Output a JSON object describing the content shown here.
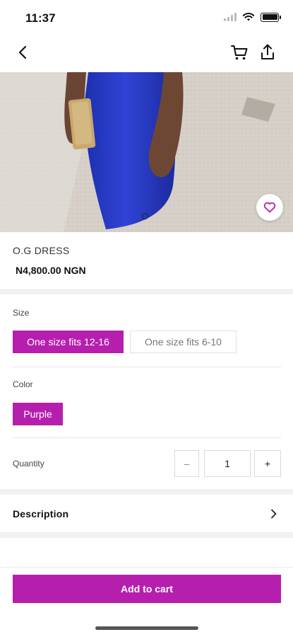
{
  "status_bar": {
    "time": "11:37"
  },
  "nav": {
    "back_icon": "chevron-left-icon",
    "cart_icon": "cart-icon",
    "share_icon": "share-icon"
  },
  "product": {
    "name": "O.G DRESS",
    "price": "N4,800.00 NGN",
    "image_description": "model in blue dress holding gold clutch",
    "carousel_index": 1,
    "carousel_count": 1
  },
  "size": {
    "label": "Size",
    "options": [
      "One size fits 12-16",
      "One size fits 6-10"
    ],
    "selected": "One size fits 12-16"
  },
  "color": {
    "label": "Color",
    "options": [
      "Purple"
    ],
    "selected": "Purple"
  },
  "quantity": {
    "label": "Quantity",
    "minus": "–",
    "value": "1",
    "plus": "+"
  },
  "description": {
    "label": "Description"
  },
  "actions": {
    "add_to_cart": "Add to cart"
  },
  "colors": {
    "accent": "#b61fae",
    "dress_blue": "#2a3fd0"
  }
}
